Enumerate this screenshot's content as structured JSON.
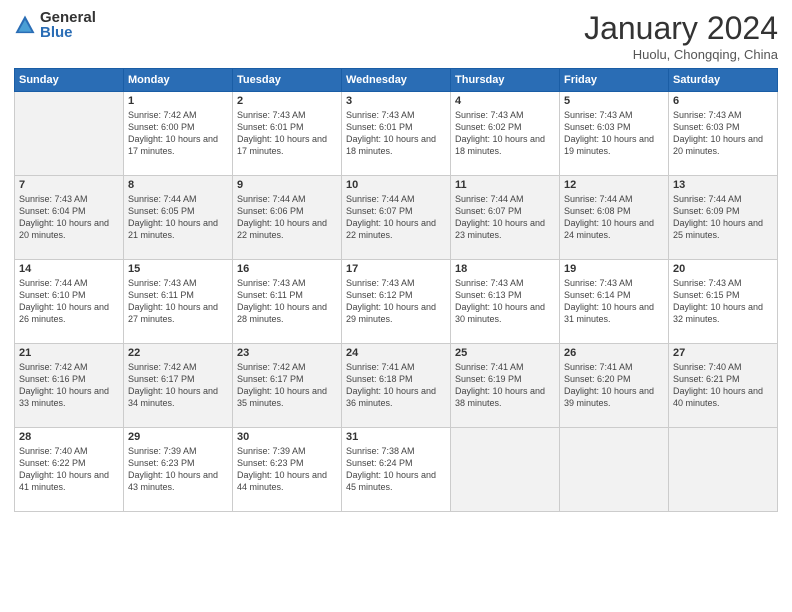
{
  "header": {
    "logo_general": "General",
    "logo_blue": "Blue",
    "month_title": "January 2024",
    "subtitle": "Huolu, Chongqing, China"
  },
  "days_of_week": [
    "Sunday",
    "Monday",
    "Tuesday",
    "Wednesday",
    "Thursday",
    "Friday",
    "Saturday"
  ],
  "weeks": [
    [
      {
        "day": "",
        "sunrise": "",
        "sunset": "",
        "daylight": ""
      },
      {
        "day": "1",
        "sunrise": "Sunrise: 7:42 AM",
        "sunset": "Sunset: 6:00 PM",
        "daylight": "Daylight: 10 hours and 17 minutes."
      },
      {
        "day": "2",
        "sunrise": "Sunrise: 7:43 AM",
        "sunset": "Sunset: 6:01 PM",
        "daylight": "Daylight: 10 hours and 17 minutes."
      },
      {
        "day": "3",
        "sunrise": "Sunrise: 7:43 AM",
        "sunset": "Sunset: 6:01 PM",
        "daylight": "Daylight: 10 hours and 18 minutes."
      },
      {
        "day": "4",
        "sunrise": "Sunrise: 7:43 AM",
        "sunset": "Sunset: 6:02 PM",
        "daylight": "Daylight: 10 hours and 18 minutes."
      },
      {
        "day": "5",
        "sunrise": "Sunrise: 7:43 AM",
        "sunset": "Sunset: 6:03 PM",
        "daylight": "Daylight: 10 hours and 19 minutes."
      },
      {
        "day": "6",
        "sunrise": "Sunrise: 7:43 AM",
        "sunset": "Sunset: 6:03 PM",
        "daylight": "Daylight: 10 hours and 20 minutes."
      }
    ],
    [
      {
        "day": "7",
        "sunrise": "Sunrise: 7:43 AM",
        "sunset": "Sunset: 6:04 PM",
        "daylight": "Daylight: 10 hours and 20 minutes."
      },
      {
        "day": "8",
        "sunrise": "Sunrise: 7:44 AM",
        "sunset": "Sunset: 6:05 PM",
        "daylight": "Daylight: 10 hours and 21 minutes."
      },
      {
        "day": "9",
        "sunrise": "Sunrise: 7:44 AM",
        "sunset": "Sunset: 6:06 PM",
        "daylight": "Daylight: 10 hours and 22 minutes."
      },
      {
        "day": "10",
        "sunrise": "Sunrise: 7:44 AM",
        "sunset": "Sunset: 6:07 PM",
        "daylight": "Daylight: 10 hours and 22 minutes."
      },
      {
        "day": "11",
        "sunrise": "Sunrise: 7:44 AM",
        "sunset": "Sunset: 6:07 PM",
        "daylight": "Daylight: 10 hours and 23 minutes."
      },
      {
        "day": "12",
        "sunrise": "Sunrise: 7:44 AM",
        "sunset": "Sunset: 6:08 PM",
        "daylight": "Daylight: 10 hours and 24 minutes."
      },
      {
        "day": "13",
        "sunrise": "Sunrise: 7:44 AM",
        "sunset": "Sunset: 6:09 PM",
        "daylight": "Daylight: 10 hours and 25 minutes."
      }
    ],
    [
      {
        "day": "14",
        "sunrise": "Sunrise: 7:44 AM",
        "sunset": "Sunset: 6:10 PM",
        "daylight": "Daylight: 10 hours and 26 minutes."
      },
      {
        "day": "15",
        "sunrise": "Sunrise: 7:43 AM",
        "sunset": "Sunset: 6:11 PM",
        "daylight": "Daylight: 10 hours and 27 minutes."
      },
      {
        "day": "16",
        "sunrise": "Sunrise: 7:43 AM",
        "sunset": "Sunset: 6:11 PM",
        "daylight": "Daylight: 10 hours and 28 minutes."
      },
      {
        "day": "17",
        "sunrise": "Sunrise: 7:43 AM",
        "sunset": "Sunset: 6:12 PM",
        "daylight": "Daylight: 10 hours and 29 minutes."
      },
      {
        "day": "18",
        "sunrise": "Sunrise: 7:43 AM",
        "sunset": "Sunset: 6:13 PM",
        "daylight": "Daylight: 10 hours and 30 minutes."
      },
      {
        "day": "19",
        "sunrise": "Sunrise: 7:43 AM",
        "sunset": "Sunset: 6:14 PM",
        "daylight": "Daylight: 10 hours and 31 minutes."
      },
      {
        "day": "20",
        "sunrise": "Sunrise: 7:43 AM",
        "sunset": "Sunset: 6:15 PM",
        "daylight": "Daylight: 10 hours and 32 minutes."
      }
    ],
    [
      {
        "day": "21",
        "sunrise": "Sunrise: 7:42 AM",
        "sunset": "Sunset: 6:16 PM",
        "daylight": "Daylight: 10 hours and 33 minutes."
      },
      {
        "day": "22",
        "sunrise": "Sunrise: 7:42 AM",
        "sunset": "Sunset: 6:17 PM",
        "daylight": "Daylight: 10 hours and 34 minutes."
      },
      {
        "day": "23",
        "sunrise": "Sunrise: 7:42 AM",
        "sunset": "Sunset: 6:17 PM",
        "daylight": "Daylight: 10 hours and 35 minutes."
      },
      {
        "day": "24",
        "sunrise": "Sunrise: 7:41 AM",
        "sunset": "Sunset: 6:18 PM",
        "daylight": "Daylight: 10 hours and 36 minutes."
      },
      {
        "day": "25",
        "sunrise": "Sunrise: 7:41 AM",
        "sunset": "Sunset: 6:19 PM",
        "daylight": "Daylight: 10 hours and 38 minutes."
      },
      {
        "day": "26",
        "sunrise": "Sunrise: 7:41 AM",
        "sunset": "Sunset: 6:20 PM",
        "daylight": "Daylight: 10 hours and 39 minutes."
      },
      {
        "day": "27",
        "sunrise": "Sunrise: 7:40 AM",
        "sunset": "Sunset: 6:21 PM",
        "daylight": "Daylight: 10 hours and 40 minutes."
      }
    ],
    [
      {
        "day": "28",
        "sunrise": "Sunrise: 7:40 AM",
        "sunset": "Sunset: 6:22 PM",
        "daylight": "Daylight: 10 hours and 41 minutes."
      },
      {
        "day": "29",
        "sunrise": "Sunrise: 7:39 AM",
        "sunset": "Sunset: 6:23 PM",
        "daylight": "Daylight: 10 hours and 43 minutes."
      },
      {
        "day": "30",
        "sunrise": "Sunrise: 7:39 AM",
        "sunset": "Sunset: 6:23 PM",
        "daylight": "Daylight: 10 hours and 44 minutes."
      },
      {
        "day": "31",
        "sunrise": "Sunrise: 7:38 AM",
        "sunset": "Sunset: 6:24 PM",
        "daylight": "Daylight: 10 hours and 45 minutes."
      },
      {
        "day": "",
        "sunrise": "",
        "sunset": "",
        "daylight": ""
      },
      {
        "day": "",
        "sunrise": "",
        "sunset": "",
        "daylight": ""
      },
      {
        "day": "",
        "sunrise": "",
        "sunset": "",
        "daylight": ""
      }
    ]
  ]
}
